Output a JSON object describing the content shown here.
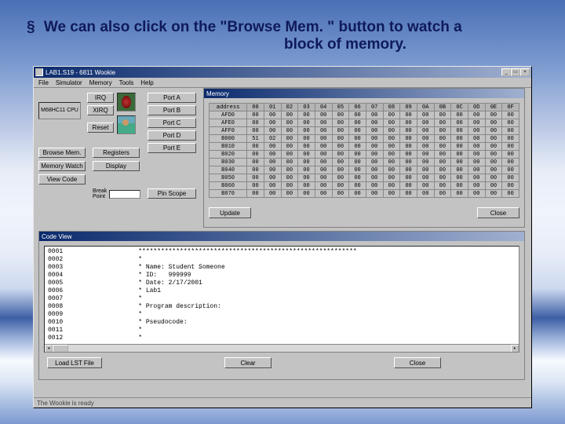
{
  "slide": {
    "bullet": "§",
    "line1": "We can also click on the \"Browse Mem. \" button to watch a",
    "line2": "block of memory."
  },
  "window": {
    "title": "LAB1.S19 - 6811 Wookie",
    "ctrls": {
      "min": "_",
      "max": "▭",
      "close": "×"
    },
    "menu": [
      "File",
      "Simulator",
      "Memory",
      "Tools",
      "Help"
    ],
    "status": "The Wookie is ready"
  },
  "cpu_label": "M68HC11 CPU",
  "int_buttons": {
    "irq": "IRQ",
    "xirq": "XIRQ",
    "reset": "Reset"
  },
  "port_buttons": [
    "Port A",
    "Port B",
    "Port C",
    "Port D",
    "Port E"
  ],
  "left_buttons": {
    "browse_mem": "Browse Mem.",
    "memory_watch": "Memory Watch",
    "view_code": "View Code",
    "registers": "Registers",
    "display": "Display"
  },
  "break": {
    "label": "Break\nPoint",
    "value": ""
  },
  "pin_scope": "Pin Scope",
  "memory": {
    "title": "Memory",
    "addr_header": "address",
    "cols": [
      "00",
      "01",
      "02",
      "03",
      "04",
      "05",
      "06",
      "07",
      "08",
      "09",
      "0A",
      "0B",
      "0C",
      "0D",
      "0E",
      "0F"
    ],
    "rows": [
      {
        "addr": "AFD0",
        "cells": [
          "00",
          "00",
          "00",
          "00",
          "00",
          "00",
          "00",
          "00",
          "00",
          "00",
          "00",
          "00",
          "00",
          "00",
          "00",
          "00"
        ]
      },
      {
        "addr": "AFE0",
        "cells": [
          "00",
          "00",
          "00",
          "00",
          "00",
          "00",
          "00",
          "00",
          "00",
          "00",
          "00",
          "00",
          "00",
          "00",
          "00",
          "00"
        ]
      },
      {
        "addr": "AFF0",
        "cells": [
          "00",
          "00",
          "00",
          "00",
          "00",
          "00",
          "00",
          "00",
          "00",
          "00",
          "00",
          "00",
          "00",
          "00",
          "00",
          "00"
        ]
      },
      {
        "addr": "B000",
        "cells": [
          "51",
          "02",
          "00",
          "00",
          "00",
          "00",
          "00",
          "00",
          "00",
          "00",
          "00",
          "00",
          "00",
          "00",
          "00",
          "00"
        ]
      },
      {
        "addr": "B010",
        "cells": [
          "00",
          "00",
          "00",
          "00",
          "00",
          "00",
          "00",
          "00",
          "00",
          "00",
          "00",
          "00",
          "00",
          "00",
          "00",
          "00"
        ]
      },
      {
        "addr": "B020",
        "cells": [
          "00",
          "00",
          "00",
          "00",
          "00",
          "00",
          "00",
          "00",
          "00",
          "00",
          "00",
          "00",
          "00",
          "00",
          "00",
          "00"
        ]
      },
      {
        "addr": "B030",
        "cells": [
          "00",
          "00",
          "00",
          "00",
          "00",
          "00",
          "00",
          "00",
          "00",
          "00",
          "00",
          "00",
          "00",
          "00",
          "00",
          "00"
        ]
      },
      {
        "addr": "B040",
        "cells": [
          "00",
          "00",
          "00",
          "00",
          "00",
          "00",
          "00",
          "00",
          "00",
          "00",
          "00",
          "00",
          "00",
          "00",
          "00",
          "00"
        ]
      },
      {
        "addr": "B050",
        "cells": [
          "00",
          "00",
          "00",
          "00",
          "00",
          "00",
          "00",
          "00",
          "00",
          "00",
          "00",
          "00",
          "00",
          "00",
          "00",
          "00"
        ]
      },
      {
        "addr": "B060",
        "cells": [
          "00",
          "00",
          "00",
          "00",
          "00",
          "00",
          "00",
          "00",
          "00",
          "00",
          "00",
          "00",
          "00",
          "00",
          "00",
          "00"
        ]
      },
      {
        "addr": "B070",
        "cells": [
          "00",
          "00",
          "00",
          "00",
          "00",
          "00",
          "00",
          "00",
          "00",
          "00",
          "00",
          "00",
          "00",
          "00",
          "00",
          "00"
        ]
      }
    ],
    "update": "Update",
    "close": "Close"
  },
  "code": {
    "title": "Code View",
    "lines": [
      {
        "n": "0001",
        "t": "**********************************************************"
      },
      {
        "n": "0002",
        "t": "*"
      },
      {
        "n": "0003",
        "t": "* Name: Student Someone"
      },
      {
        "n": "0004",
        "t": "* ID:   999999"
      },
      {
        "n": "0005",
        "t": "* Date: 2/17/2001"
      },
      {
        "n": "0006",
        "t": "* Lab1"
      },
      {
        "n": "0007",
        "t": "*"
      },
      {
        "n": "0008",
        "t": "* Program description:"
      },
      {
        "n": "0009",
        "t": "*"
      },
      {
        "n": "0010",
        "t": "* Pseudocode:"
      },
      {
        "n": "0011",
        "t": "*"
      },
      {
        "n": "0012",
        "t": "*"
      }
    ],
    "load": "Load LST File",
    "clear": "Clear",
    "close": "Close"
  }
}
